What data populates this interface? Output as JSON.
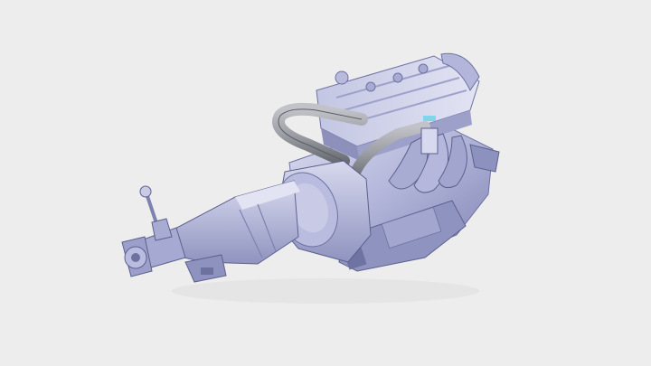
{
  "scene": {
    "subject": "engine-and-gearbox-3d-model",
    "colors": {
      "background": "#ededed",
      "body_light": "#c9cbe6",
      "body_mid": "#a9acd2",
      "body_dark": "#7e82b0",
      "shadow": "#5d618e",
      "highlight": "#e6e7f6",
      "hose": "#9ea0a6",
      "hose_dark": "#6f7178",
      "accent_cyan": "#7fd6e8"
    },
    "icons": {
      "engine": "engine-block-icon",
      "gearbox": "gearbox-icon",
      "shifter": "gear-shifter-icon"
    }
  }
}
